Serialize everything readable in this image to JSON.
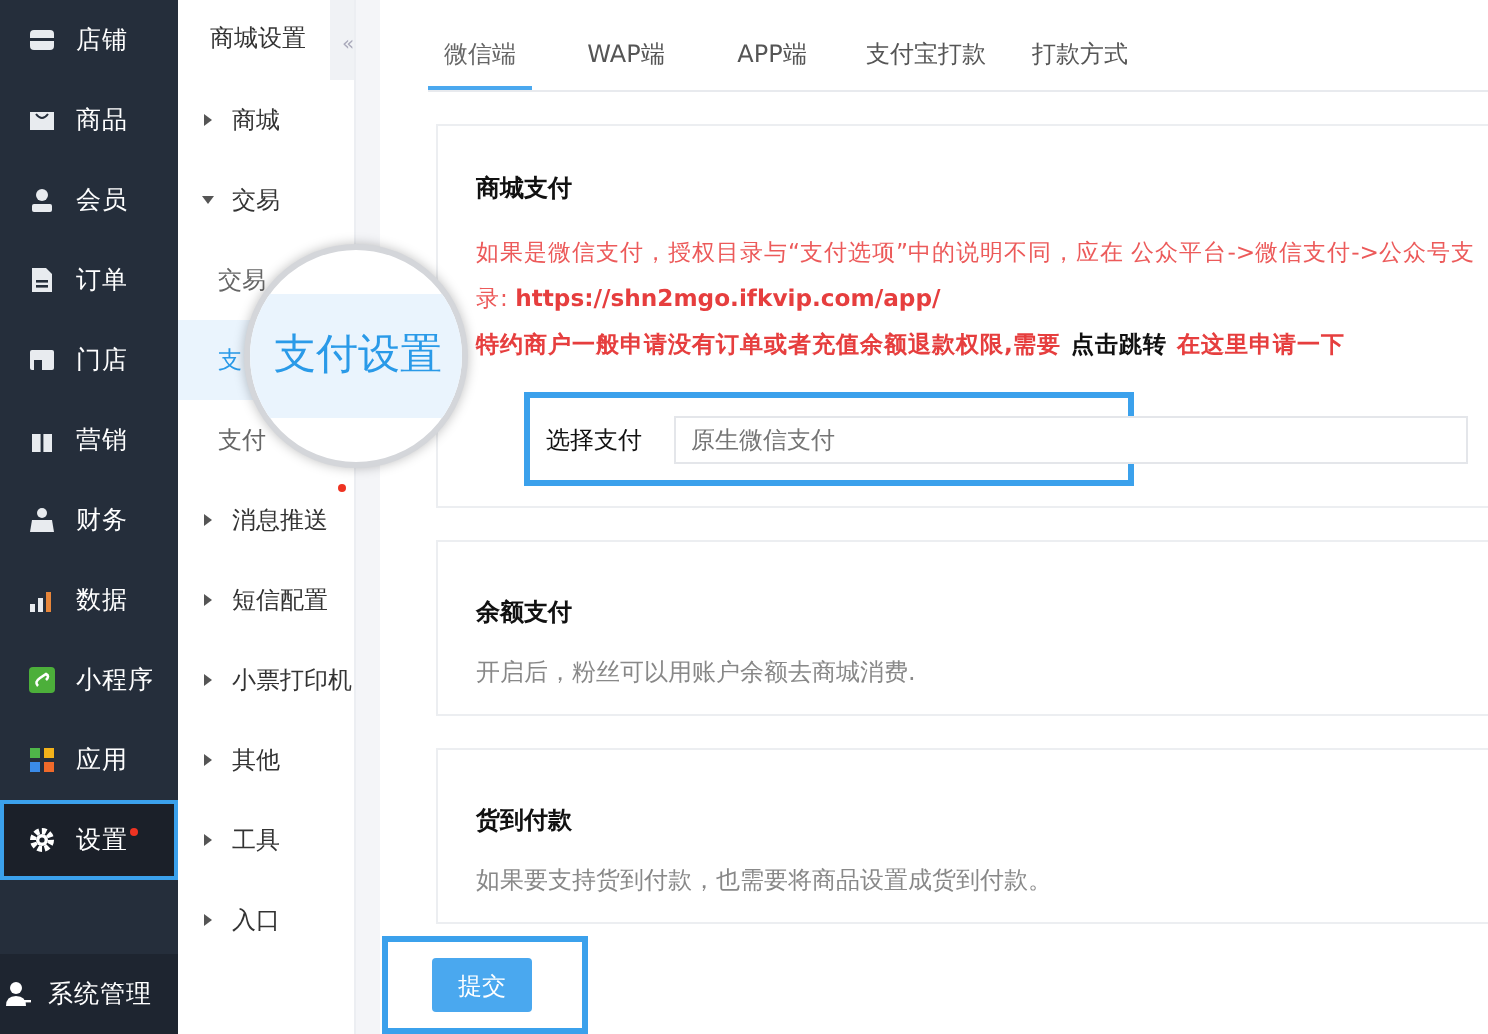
{
  "main_nav": {
    "items": [
      {
        "label": "店铺",
        "selected": false,
        "dot": false
      },
      {
        "label": "商品",
        "selected": false,
        "dot": false
      },
      {
        "label": "会员",
        "selected": false,
        "dot": false
      },
      {
        "label": "订单",
        "selected": false,
        "dot": false
      },
      {
        "label": "门店",
        "selected": false,
        "dot": false
      },
      {
        "label": "营销",
        "selected": false,
        "dot": false
      },
      {
        "label": "财务",
        "selected": false,
        "dot": false
      },
      {
        "label": "数据",
        "selected": false,
        "dot": false
      },
      {
        "label": "小程序",
        "selected": false,
        "dot": false
      },
      {
        "label": "应用",
        "selected": false,
        "dot": false
      },
      {
        "label": "设置",
        "selected": true,
        "dot": true
      }
    ],
    "footer": {
      "label": "系统管理"
    }
  },
  "sub_nav": {
    "title": "商城设置",
    "collapse": "«",
    "items": [
      {
        "label": "商城",
        "expanded": false,
        "dot": false
      },
      {
        "label": "交易",
        "expanded": true,
        "dot": false,
        "children": [
          {
            "label": "交易",
            "selected": false
          },
          {
            "label": "支",
            "selected": true
          },
          {
            "label": "支付",
            "selected": false
          }
        ]
      },
      {
        "label": "消息推送",
        "expanded": false,
        "dot": true
      },
      {
        "label": "短信配置",
        "expanded": false,
        "dot": false
      },
      {
        "label": "小票打印机",
        "expanded": false,
        "dot": false
      },
      {
        "label": "其他",
        "expanded": false,
        "dot": false
      },
      {
        "label": "工具",
        "expanded": false,
        "dot": false
      },
      {
        "label": "入口",
        "expanded": false,
        "dot": false
      }
    ]
  },
  "magnifier": {
    "text": "支付设置"
  },
  "tabs": [
    {
      "label": "微信端",
      "selected": true
    },
    {
      "label": "WAP端",
      "selected": false
    },
    {
      "label": "APP端",
      "selected": false
    },
    {
      "label": "支付宝打款",
      "selected": false
    },
    {
      "label": "打款方式",
      "selected": false
    }
  ],
  "sections": [
    {
      "kind": "form",
      "title": "商城支付",
      "notes": [
        [
          {
            "text": "如果是微信支付，授权目录与“支付选项”中的说明不同，应在 公众平台->微信支付->公众号支",
            "kind": "plain"
          }
        ],
        [
          {
            "text": "录: ",
            "kind": "plain"
          },
          {
            "text": "https://shn2mgo.ifkvip.com/app/",
            "kind": "bold"
          }
        ],
        [
          {
            "text": "特约商户一般申请没有订单或者充值余额退款权限,需要",
            "kind": "bold"
          },
          {
            "text": "点击跳转",
            "kind": "link"
          },
          {
            "text": "在这里申请一下",
            "kind": "bold"
          }
        ]
      ],
      "field": {
        "label": "选择支付",
        "placeholder": "原生微信支付",
        "highlighted": true
      }
    },
    {
      "kind": "text",
      "title": "余额支付",
      "description": "开启后，粉丝可以用账户余额去商城消费."
    },
    {
      "kind": "text",
      "title": "货到付款",
      "description": "如果要支持货到付款，也需要将商品设置成货到付款。"
    }
  ],
  "submit": {
    "label": "提交",
    "highlighted": true
  }
}
